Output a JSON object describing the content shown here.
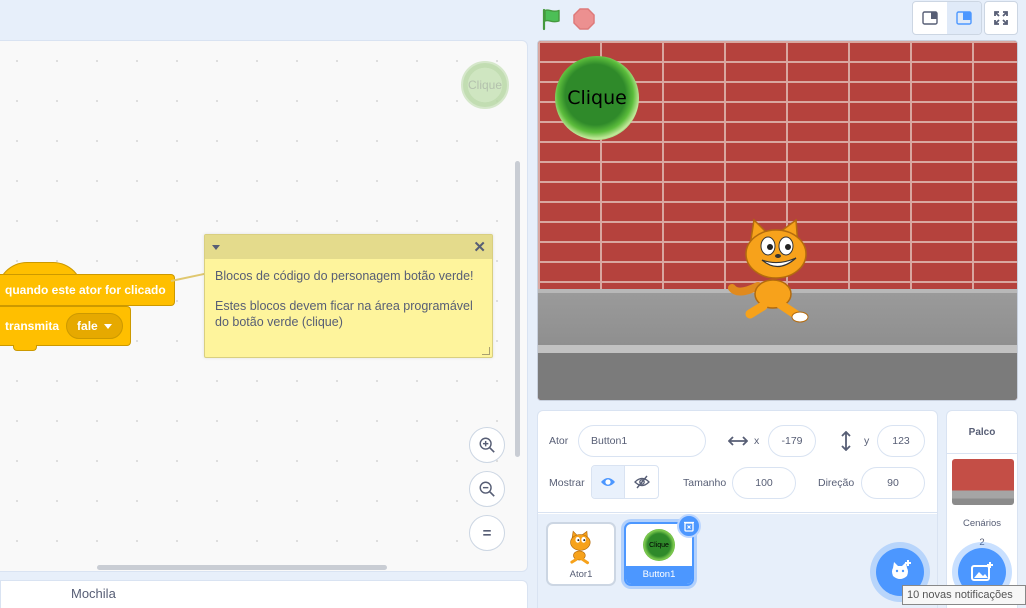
{
  "code_area": {
    "ghost_sprite_label": "Clique",
    "hat_block_label": "quando este ator for clicado",
    "command_label": "transmita",
    "broadcast_value": "fale",
    "comment": {
      "line1": "Blocos de código do personagem botão verde!",
      "line2": "Estes blocos devem ficar na área programável do botão verde (clique)"
    },
    "zoom_reset_label": "="
  },
  "backpack": {
    "label": "Mochila"
  },
  "stage": {
    "button_label": "Clique"
  },
  "sprite_info": {
    "sprite_label": "Ator",
    "sprite_name": "Button1",
    "x_label": "x",
    "x_value": "-179",
    "y_label": "y",
    "y_value": "123",
    "show_label": "Mostrar",
    "size_label": "Tamanho",
    "size_value": "100",
    "direction_label": "Direção",
    "direction_value": "90"
  },
  "sprites": [
    {
      "name": "Ator1",
      "selected": false
    },
    {
      "name": "Button1",
      "selected": true,
      "thumb_label": "Clique"
    }
  ],
  "stage_selector": {
    "title": "Palco",
    "backdrops_label": "Cenários",
    "backdrops_count": "2"
  },
  "notification": {
    "text": "10 novas notificações"
  },
  "colors": {
    "accent": "#4c97ff",
    "events_block": "#ffbf00",
    "comment_bg": "#fef49c",
    "go_flag": "#4cbf56",
    "stop": "#ec5959"
  }
}
